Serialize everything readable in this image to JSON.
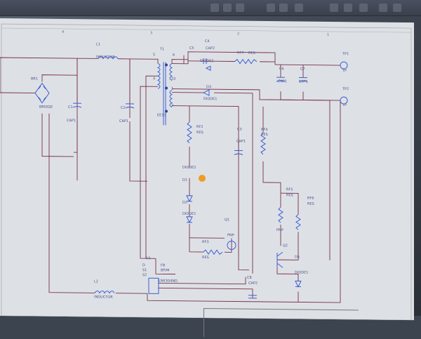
{
  "ruler": {
    "markers": [
      "4",
      "3",
      "2",
      "1"
    ]
  },
  "components": {
    "L1": {
      "ref": "L1",
      "value": "INDUCTOR"
    },
    "L2": {
      "ref": "L2",
      "value": "INDUCTOR"
    },
    "BR1": {
      "ref": "BR1",
      "value": "BRIDGE"
    },
    "C1": {
      "ref": "C1",
      "value": "CAP1"
    },
    "C2": {
      "ref": "C2",
      "value": "CAP1"
    },
    "T1": {
      "ref": "T1",
      "value": "EE13",
      "pins": [
        "5",
        "6",
        "4",
        "10",
        "1",
        "2"
      ]
    },
    "C4": {
      "ref": "C4",
      "value": "CAP2"
    },
    "C5": {
      "ref": "C5"
    },
    "D4": {
      "ref": "DIODE2"
    },
    "R7": {
      "ref": "RF7",
      "value": "RES"
    },
    "C6": {
      "ref": "C6",
      "value": "CAP1"
    },
    "C7": {
      "ref": "C7",
      "value": "CAP1"
    },
    "TP1": {
      "ref": "TP1",
      "value": "TP"
    },
    "TP2": {
      "ref": "TP2",
      "value": "TP"
    },
    "D3": {
      "ref": "D3",
      "value": "DIODE1"
    },
    "R2": {
      "ref": "RF2",
      "value": "RES"
    },
    "C3": {
      "ref": "C3",
      "value": "CAP1"
    },
    "R4": {
      "ref": "RF4",
      "value": "RES"
    },
    "D1": {
      "ref": "D1",
      "value": "DIODE2"
    },
    "D2": {
      "ref": "D2",
      "value": "DIODE1"
    },
    "Q1": {
      "ref": "Q1",
      "value": "PNP"
    },
    "R3": {
      "ref": "RF3",
      "value": "RES"
    },
    "R5": {
      "ref": "RF5",
      "value": "RES"
    },
    "R6": {
      "ref": "RF6",
      "value": "RES"
    },
    "Q2": {
      "ref": "Q2",
      "value": "PNP"
    },
    "D6": {
      "ref": "D6",
      "value": "DIODE1"
    },
    "U1": {
      "ref": "U1",
      "value": "LNK304ND",
      "pins": [
        "FB",
        "BP/M",
        "D",
        "S1",
        "S2"
      ]
    },
    "C8": {
      "ref": "C8",
      "value": "CAP2"
    }
  },
  "colors": {
    "wire": "#7a2f45",
    "component": "#3d5fd0",
    "label": "#4a4f8a",
    "sheet": "#dde1e6",
    "accent": "#f39a22"
  }
}
